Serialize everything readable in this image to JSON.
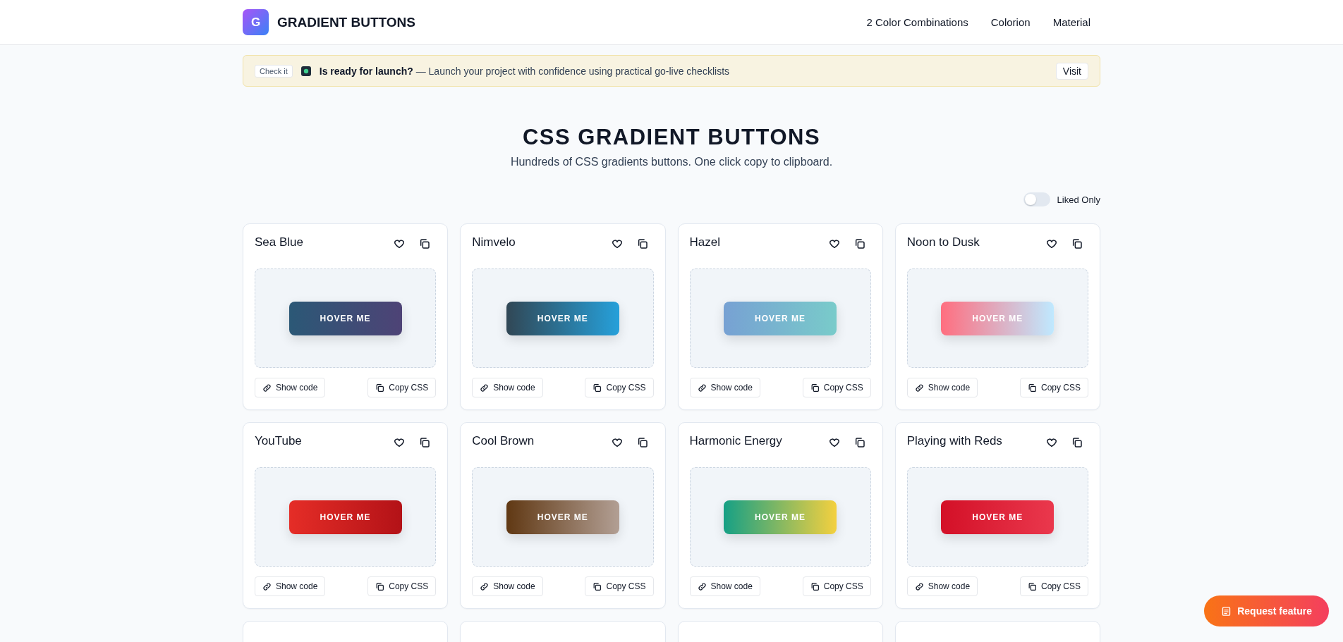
{
  "header": {
    "logo_letter": "G",
    "title": "GRADIENT BUTTONS",
    "nav": [
      "2 Color Combinations",
      "Colorion",
      "Material"
    ]
  },
  "banner": {
    "tag": "Check it",
    "text": "**Is ready for launch?** — Launch your project with confidence using practical go-live checklists",
    "button": "Visit"
  },
  "hero": {
    "title": "CSS GRADIENT BUTTONS",
    "subtitle": "Hundreds of CSS gradients buttons. One click copy to clipboard."
  },
  "filter": {
    "label": "Liked Only",
    "on": false
  },
  "cards": [
    {
      "kind": "full",
      "title": "Sea Blue",
      "liked": false,
      "stops": [
        {
          "color": "#2b5876"
        },
        {
          "color": "#4e4376"
        }
      ],
      "preview": "HOVER ME",
      "show_code": "Show code",
      "copy_css": "Copy CSS"
    },
    {
      "kind": "full",
      "title": "Nimvelo",
      "liked": false,
      "stops": [
        {
          "color": "#314755"
        },
        {
          "color": "#26a0da"
        }
      ],
      "preview": "HOVER ME",
      "show_code": "Show code",
      "copy_css": "Copy CSS"
    },
    {
      "kind": "full",
      "title": "Hazel",
      "liked": false,
      "stops": [
        {
          "color": "#77a1d3"
        },
        {
          "color": "#79cbca"
        }
      ],
      "preview": "HOVER ME",
      "show_code": "Show code",
      "copy_css": "Copy CSS"
    },
    {
      "kind": "full",
      "title": "Noon to Dusk",
      "liked": false,
      "stops": [
        {
          "color": "#ff6e7f"
        },
        {
          "color": "#bfe9ff"
        }
      ],
      "preview": "HOVER ME",
      "show_code": "Show code",
      "copy_css": "Copy CSS"
    },
    {
      "kind": "full",
      "title": "YouTube",
      "liked": false,
      "stops": [
        {
          "color": "#e52d27"
        },
        {
          "color": "#b31217"
        }
      ],
      "preview": "HOVER ME",
      "show_code": "Show code",
      "copy_css": "Copy CSS"
    },
    {
      "kind": "full",
      "title": "Cool Brown",
      "liked": false,
      "stops": [
        {
          "color": "#603813"
        },
        {
          "color": "#b29f94"
        }
      ],
      "preview": "HOVER ME",
      "show_code": "Show code",
      "copy_css": "Copy CSS"
    },
    {
      "kind": "full",
      "title": "Harmonic Energy",
      "liked": false,
      "stops": [
        {
          "color": "#16a085"
        },
        {
          "color": "#f4d03f"
        }
      ],
      "preview": "HOVER ME",
      "show_code": "Show code",
      "copy_css": "Copy CSS"
    },
    {
      "kind": "full",
      "title": "Playing with Reds",
      "liked": false,
      "stops": [
        {
          "color": "#d31027"
        },
        {
          "color": "#ea384d"
        }
      ],
      "preview": "HOVER ME",
      "show_code": "Show code",
      "copy_css": "Copy CSS"
    },
    {
      "kind": "cut"
    },
    {
      "kind": "cut"
    },
    {
      "kind": "cut"
    },
    {
      "kind": "cut"
    }
  ],
  "request_button": "Request feature"
}
